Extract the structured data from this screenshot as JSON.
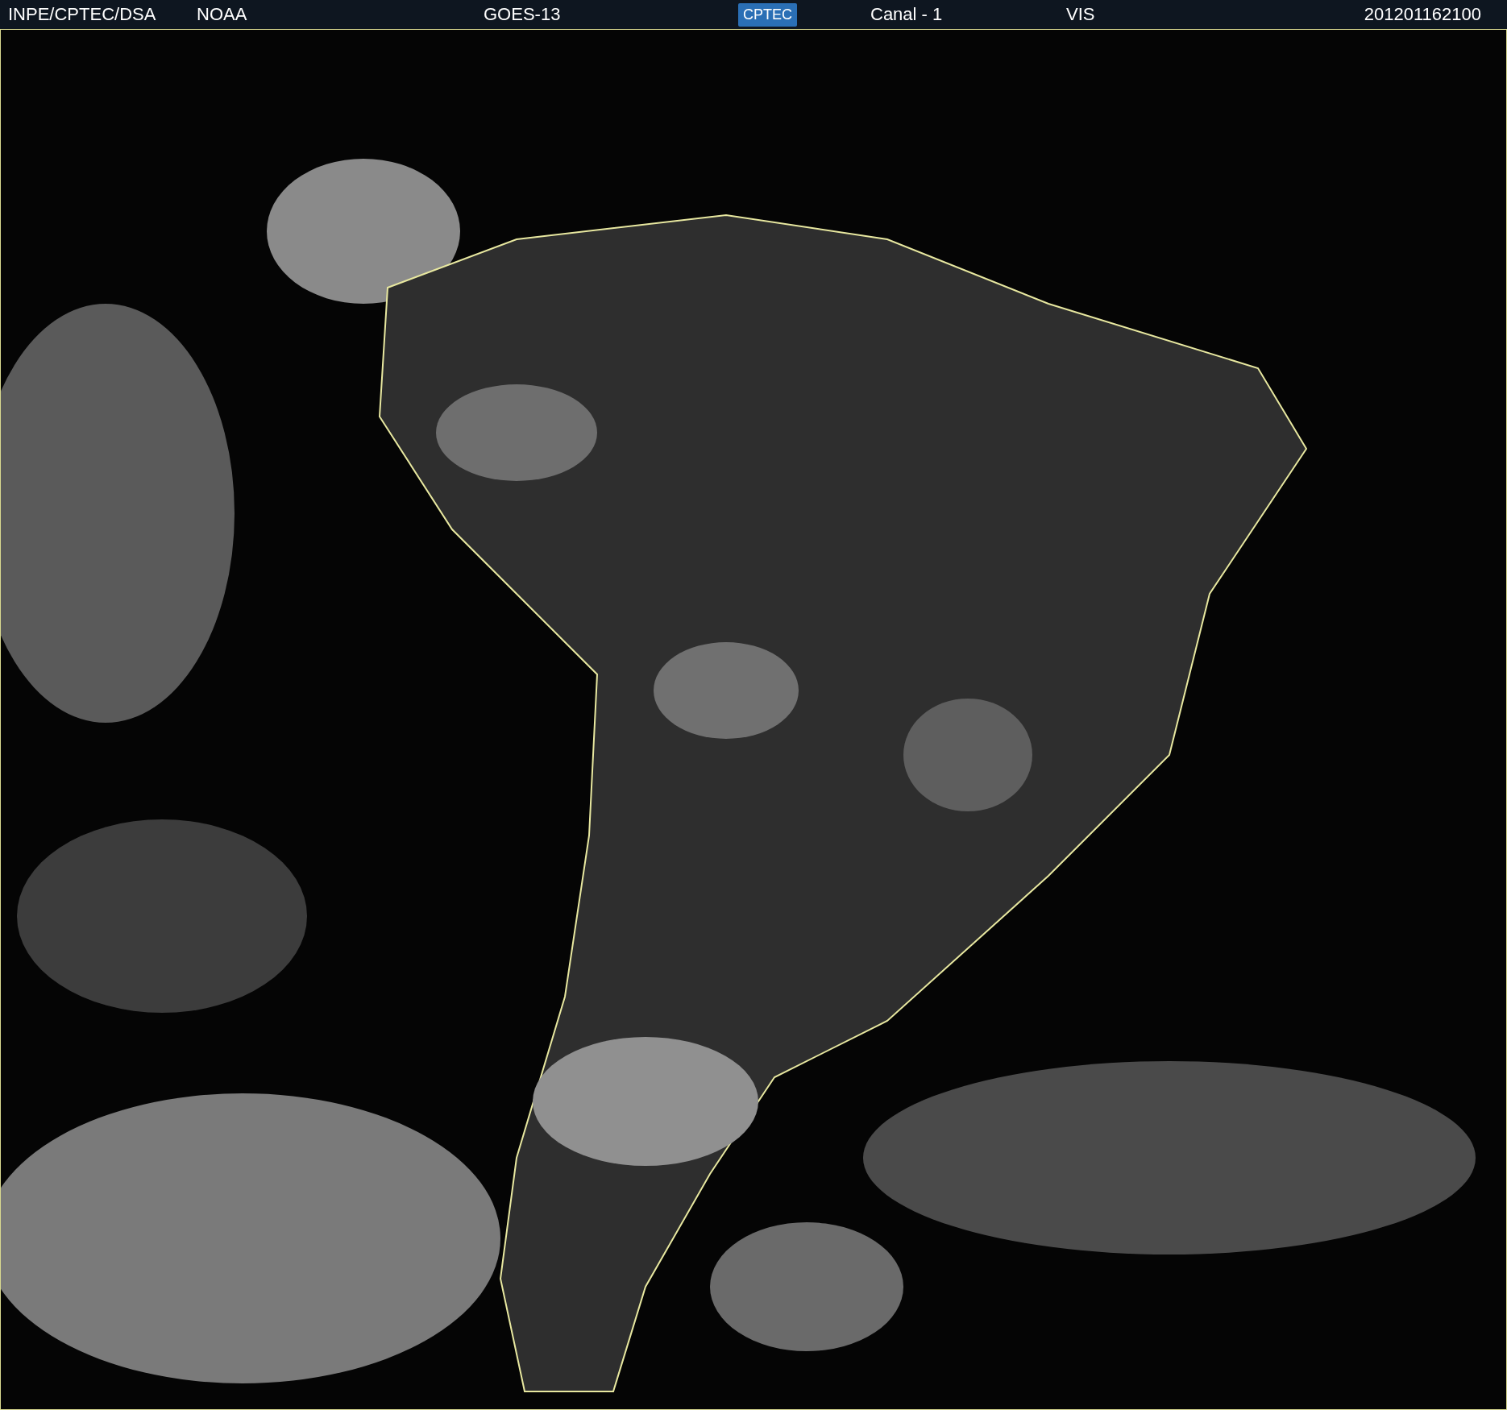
{
  "header": {
    "items": [
      {
        "kind": "text",
        "text": "INPE/CPTEC/DSA"
      },
      {
        "kind": "text",
        "text": "NOAA"
      },
      {
        "kind": "text",
        "text": "GOES-13"
      },
      {
        "kind": "logo",
        "text": "CPTEC"
      },
      {
        "kind": "text",
        "text": "Canal - 1"
      },
      {
        "kind": "text",
        "text": "VIS"
      },
      {
        "kind": "text",
        "text": "201201162100"
      }
    ]
  }
}
